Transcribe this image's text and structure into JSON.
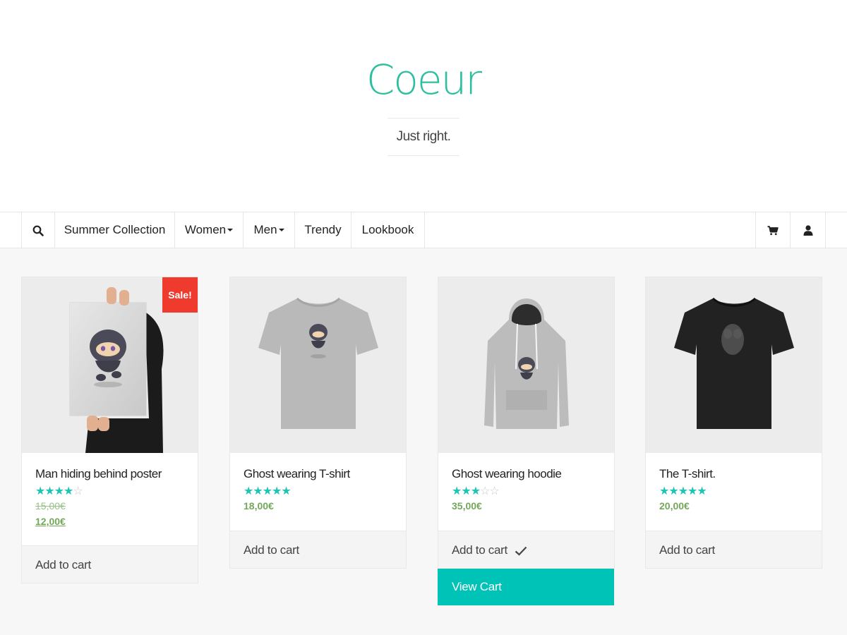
{
  "site": {
    "title": "Coeur",
    "tagline": "Just right.",
    "brand_color": "#2bbf9f"
  },
  "nav": {
    "search_icon": "search-icon",
    "items": [
      {
        "label": "Summer Collection",
        "has_caret": false
      },
      {
        "label": "Women",
        "has_caret": true
      },
      {
        "label": "Men",
        "has_caret": true
      },
      {
        "label": "Trendy",
        "has_caret": false
      },
      {
        "label": "Lookbook",
        "has_caret": false
      }
    ],
    "cart_icon": "cart-icon",
    "account_icon": "user-icon"
  },
  "products": [
    {
      "title": "Man hiding behind poster",
      "rating": 4,
      "rating_max": 5,
      "price_old": "15,00€",
      "price": "12,00€",
      "sale_badge": "Sale!",
      "add_to_cart": "Add to cart",
      "image": "poster"
    },
    {
      "title": "Ghost wearing T-shirt",
      "rating": 5,
      "rating_max": 5,
      "price": "18,00€",
      "add_to_cart": "Add to cart",
      "image": "grey-tshirt"
    },
    {
      "title": "Ghost wearing hoodie",
      "rating": 3,
      "rating_max": 5,
      "price": "35,00€",
      "add_to_cart": "Add to cart",
      "added": true,
      "view_cart": "View Cart",
      "image": "hoodie"
    },
    {
      "title": "The T-shirt.",
      "rating": 5,
      "rating_max": 5,
      "price": "20,00€",
      "add_to_cart": "Add to cart",
      "image": "black-tshirt"
    }
  ],
  "colors": {
    "accent": "#00c3b8",
    "star": "#1ec4b4",
    "price": "#73a85a",
    "sale": "#ef3b2d"
  }
}
